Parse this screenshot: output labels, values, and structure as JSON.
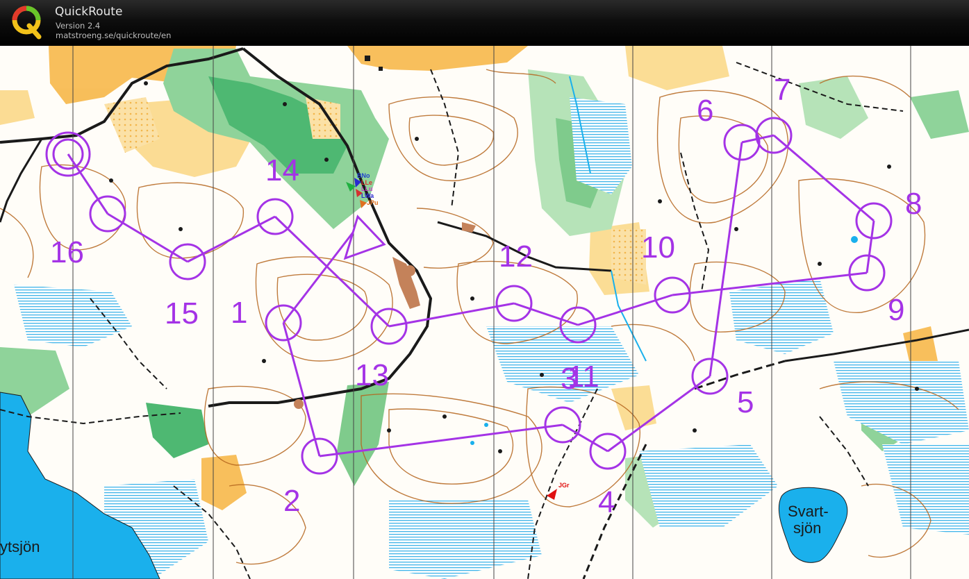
{
  "header": {
    "app_name": "QuickRoute",
    "version": "Version 2.4",
    "url": "matstroeng.se/quickroute/en",
    "logo_letter": "Q"
  },
  "map": {
    "lake_names": [
      "Svart-",
      "sjön",
      "ytsjön"
    ],
    "course_color": "#a433e6",
    "start_control": "start-triangle",
    "finish_control": "finish-double-circle",
    "control_labels": [
      "1",
      "2",
      "3",
      "4",
      "5",
      "6",
      "7",
      "8",
      "9",
      "10",
      "11",
      "12",
      "13",
      "14",
      "15",
      "16"
    ],
    "runner_tags": [
      {
        "text": "BNo",
        "color": "#1f3fd0"
      },
      {
        "text": "LLe",
        "color": "#d43030"
      },
      {
        "text": "LLu",
        "color": "#c040c0"
      },
      {
        "text": "LWa",
        "color": "#2a2ad0"
      },
      {
        "text": "JPu",
        "color": "#e07020"
      },
      {
        "text": "JGr",
        "color": "#e01010"
      }
    ],
    "colors": {
      "open_land": "#f7b84a",
      "forest_green": "#89cf8e",
      "dense_green": "#4cb56f",
      "water": "#1ab0ec",
      "marsh": "#3fb4e8",
      "contours": "#b5651d",
      "roads": "#1a1a1a"
    }
  }
}
